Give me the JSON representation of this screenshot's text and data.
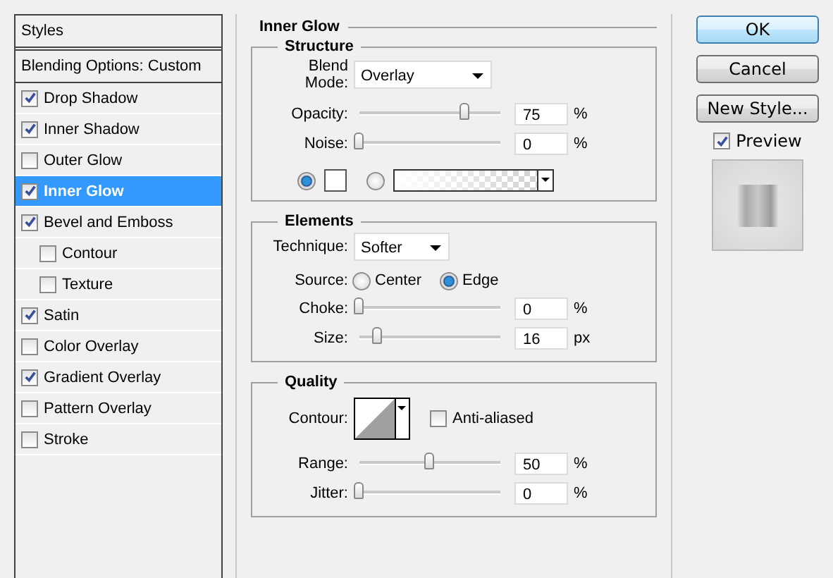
{
  "styles_panel": {
    "title": "Styles",
    "blending_options": "Blending Options: Custom",
    "items": [
      {
        "label": "Drop Shadow",
        "checked": true,
        "selected": false
      },
      {
        "label": "Inner Shadow",
        "checked": true,
        "selected": false
      },
      {
        "label": "Outer Glow",
        "checked": false,
        "selected": false
      },
      {
        "label": "Inner Glow",
        "checked": true,
        "selected": true
      },
      {
        "label": "Bevel and Emboss",
        "checked": true,
        "selected": false,
        "children": [
          {
            "label": "Contour",
            "checked": false,
            "selected": false
          },
          {
            "label": "Texture",
            "checked": false,
            "selected": false
          }
        ]
      },
      {
        "label": "Satin",
        "checked": true,
        "selected": false
      },
      {
        "label": "Color Overlay",
        "checked": false,
        "selected": false
      },
      {
        "label": "Gradient Overlay",
        "checked": true,
        "selected": false
      },
      {
        "label": "Pattern Overlay",
        "checked": false,
        "selected": false
      },
      {
        "label": "Stroke",
        "checked": false,
        "selected": false
      }
    ]
  },
  "inner_glow": {
    "title": "Inner Glow",
    "structure": {
      "title": "Structure",
      "blend_mode": {
        "label": "Blend Mode:",
        "value": "Overlay"
      },
      "sliders": [
        {
          "label": "Opacity:",
          "value": "75",
          "unit": "%",
          "level": 0.75
        },
        {
          "label": "Noise:",
          "value": "0",
          "unit": "%",
          "level": 0
        }
      ],
      "fill": [
        {
          "kind": "color",
          "selected": true
        },
        {
          "kind": "gradient",
          "selected": false
        }
      ]
    },
    "elements": {
      "title": "Elements",
      "technique": {
        "label": "Technique:",
        "value": "Softer"
      },
      "source": {
        "label": "Source:",
        "options": [
          {
            "label": "Center",
            "selected": false
          },
          {
            "label": "Edge",
            "selected": true
          }
        ]
      },
      "sliders": [
        {
          "label": "Choke:",
          "value": "0",
          "unit": "%",
          "level": 0
        },
        {
          "label": "Size:",
          "value": "16",
          "unit": "px",
          "level": 0.13
        }
      ]
    },
    "quality": {
      "title": "Quality",
      "contour": {
        "label": "Contour:"
      },
      "anti_aliased": {
        "label": "Anti-aliased",
        "checked": false
      },
      "sliders": [
        {
          "label": "Range:",
          "value": "50",
          "unit": "%",
          "level": 0.5
        },
        {
          "label": "Jitter:",
          "value": "0",
          "unit": "%",
          "level": 0
        }
      ]
    }
  },
  "buttons": [
    {
      "label": "OK",
      "kind": "default"
    },
    {
      "label": "Cancel",
      "kind": "normal"
    },
    {
      "label": "New Style...",
      "kind": "normal"
    }
  ],
  "preview": {
    "label": "Preview",
    "checked": true
  }
}
